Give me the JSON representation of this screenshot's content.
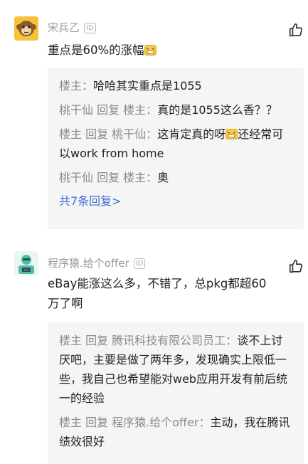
{
  "comments": [
    {
      "author": "宋兵乙",
      "badge": "ID",
      "text": "重点是60%的涨幅",
      "replies": [
        {
          "who": "楼主：",
          "text": "哈哈其实重点是1055"
        },
        {
          "who": "桃干仙 回复 楼主：",
          "text": "真的是1055这么香？？"
        },
        {
          "who": "楼主 回复 桃干仙：",
          "text_before": "这肯定真的呀",
          "text_after": "还经常可以work from home"
        },
        {
          "who": "桃干仙 回复 楼主：",
          "text": "奥"
        }
      ],
      "more": "共7条回复>"
    },
    {
      "author": "程序猿.给个offer",
      "badge": "ID",
      "text": "eBay能涨这么多，不错了，总pkg都超60万了啊",
      "replies": [
        {
          "who": "楼主 回复 腾讯科技有限公司员工：",
          "text": "谈不上讨厌吧，主要是做了两年多，发现确实上限低一些，我自己也希望能对web应用开发有前后统一的经验"
        },
        {
          "who": "楼主 回复 程序猿.给个offer：",
          "text": "主动，我在腾讯绩效很好"
        }
      ]
    }
  ],
  "colors": {
    "meta_gray": "#999999",
    "link_blue": "#3a6ed8",
    "reply_bg": "#f5f5f5",
    "avatar1_bg": "#f6c23a",
    "avatar2_bg": "#4fbf9f"
  },
  "icons": {
    "like": "thumbs-up-icon",
    "emoji": "grin-emoji-icon"
  }
}
